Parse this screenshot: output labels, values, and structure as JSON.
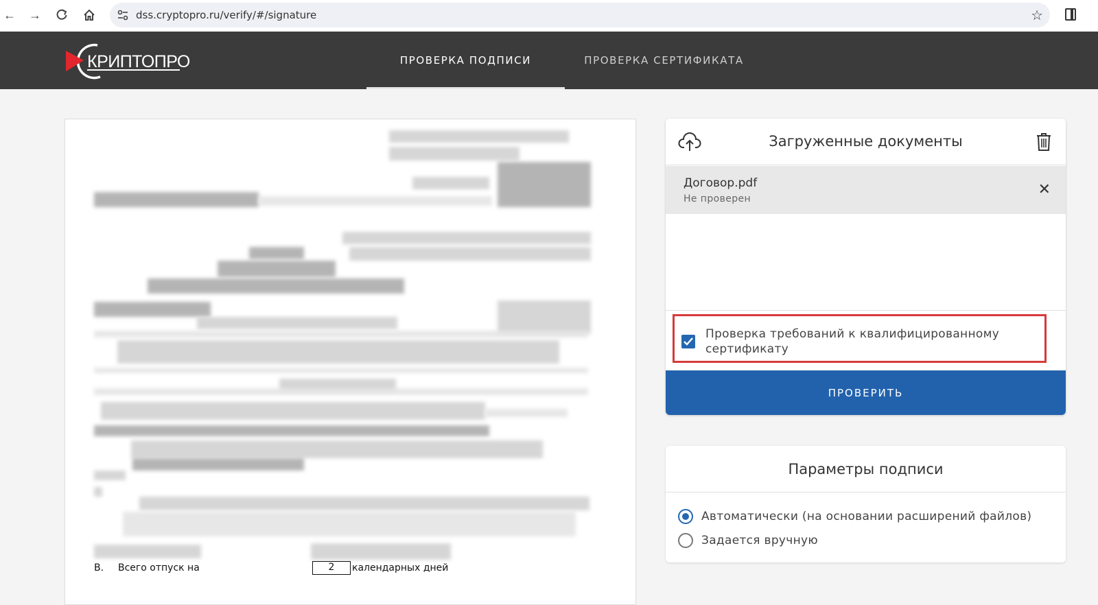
{
  "browser": {
    "url": "dss.cryptopro.ru/verify/#/signature"
  },
  "header": {
    "logo_text": "КРИПТОПРО",
    "tabs": [
      {
        "label": "ПРОВЕРКА ПОДПИСИ",
        "active": true
      },
      {
        "label": "ПРОВЕРКА СЕРТИФИКАТА",
        "active": false
      }
    ]
  },
  "document_preview": {
    "footer_prefix": "В.",
    "footer_text": "Всего отпуск на",
    "footer_value": "2",
    "footer_suffix": "календарных дней"
  },
  "uploaded_docs": {
    "title": "Загруженные документы",
    "files": [
      {
        "name": "Договор.pdf",
        "status": "Не проверен"
      }
    ],
    "qualified_check": {
      "label": "Проверка требований к квалифицированному сертификату",
      "checked": true
    },
    "verify_button": "ПРОВЕРИТЬ"
  },
  "signature_params": {
    "title": "Параметры подписи",
    "options": [
      {
        "label": "Автоматически (на основании расширений файлов)",
        "selected": true
      },
      {
        "label": "Задается вручную",
        "selected": false
      }
    ]
  },
  "colors": {
    "header_bg": "#3b3b3b",
    "accent_blue": "#2262ad",
    "highlight_red": "#d63a3a"
  }
}
